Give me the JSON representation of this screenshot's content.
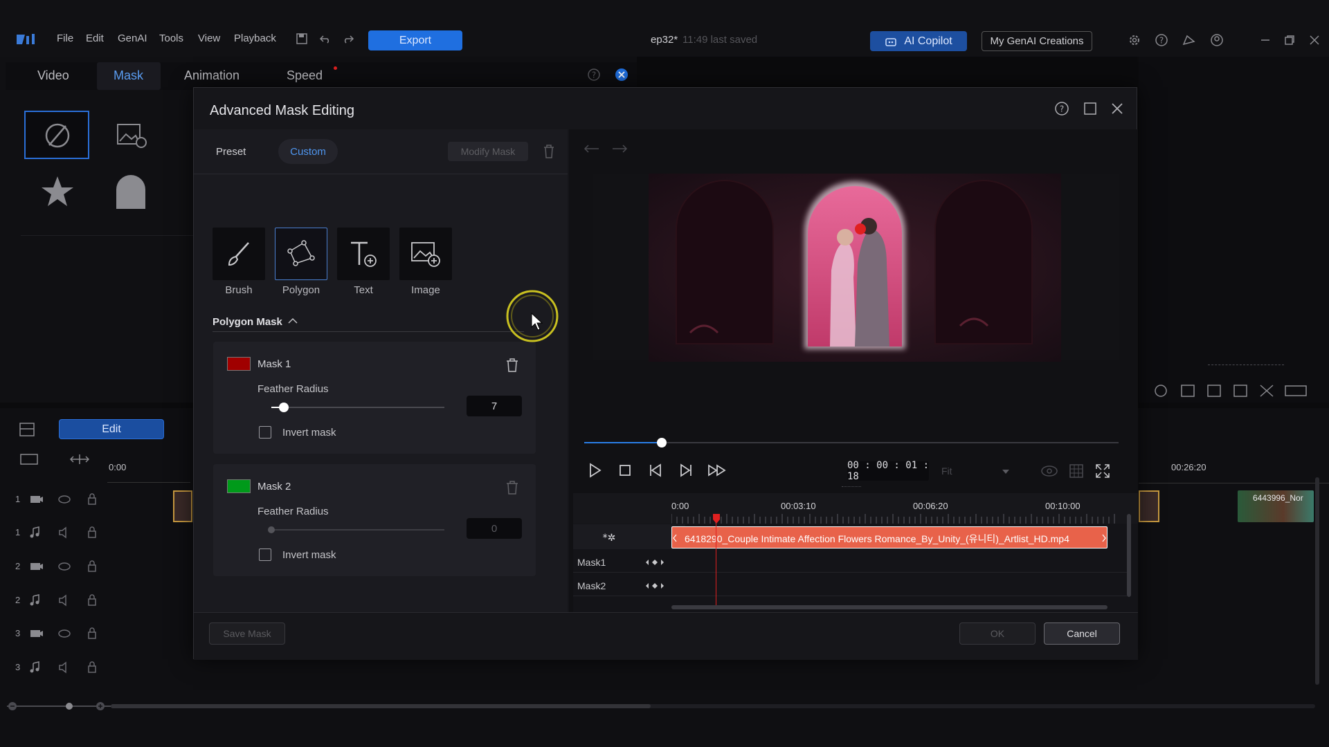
{
  "menubar": {
    "menus": [
      "File",
      "Edit",
      "GenAI",
      "Tools",
      "View",
      "Playback"
    ],
    "export_label": "Export",
    "project_name": "ep32*",
    "last_saved": "11:49 last saved",
    "ai_copilot_label": "AI Copilot",
    "my_genai_label": "My GenAI Creations"
  },
  "background_tabs": [
    "Video",
    "Mask",
    "Animation",
    "Speed"
  ],
  "background": {
    "edit_label": "Edit",
    "ruler_start": "0:00",
    "ruler_right": "00:26:20",
    "clip_right": "6443996_Nor",
    "track_numbers": [
      "1",
      "1",
      "2",
      "2",
      "3",
      "3"
    ]
  },
  "dialog": {
    "title": "Advanced Mask Editing",
    "preset_tab": "Preset",
    "custom_tab": "Custom",
    "modify_mask_label": "Modify Mask",
    "tools": [
      {
        "label": "Brush",
        "icon": "brush-icon"
      },
      {
        "label": "Polygon",
        "icon": "polygon-icon"
      },
      {
        "label": "Text",
        "icon": "text-icon"
      },
      {
        "label": "Image",
        "icon": "image-icon"
      }
    ],
    "section_title": "Polygon Mask",
    "masks": [
      {
        "name": "Mask 1",
        "color": "#a00000",
        "feather_label": "Feather Radius",
        "feather_value": "7",
        "feather_fraction": 0.07,
        "invert_label": "Invert mask",
        "active": true
      },
      {
        "name": "Mask 2",
        "color": "#009a1a",
        "feather_label": "Feather Radius",
        "feather_value": "0",
        "feather_fraction": 0.0,
        "invert_label": "Invert mask",
        "active": false
      }
    ],
    "player": {
      "progress_fraction": 0.145,
      "timecode": "00 : 00 : 01 : 18",
      "zoom_select": "Fit"
    },
    "timeline": {
      "ruler_labels": [
        "0:00",
        "00:03:10",
        "00:06:20",
        "00:10:00"
      ],
      "clip_name": "6418290_Couple Intimate Affection Flowers Romance_By_Unity_(유니티)_Artlist_HD.mp4",
      "tracks": [
        "Mask1",
        "Mask2"
      ]
    },
    "save_mask_label": "Save Mask",
    "ok_label": "OK",
    "cancel_label": "Cancel"
  },
  "colors": {
    "accent": "#1f6fe0",
    "clip": "#e8624a",
    "playhead": "#e02020",
    "cursor_ring": "#c8c020"
  }
}
